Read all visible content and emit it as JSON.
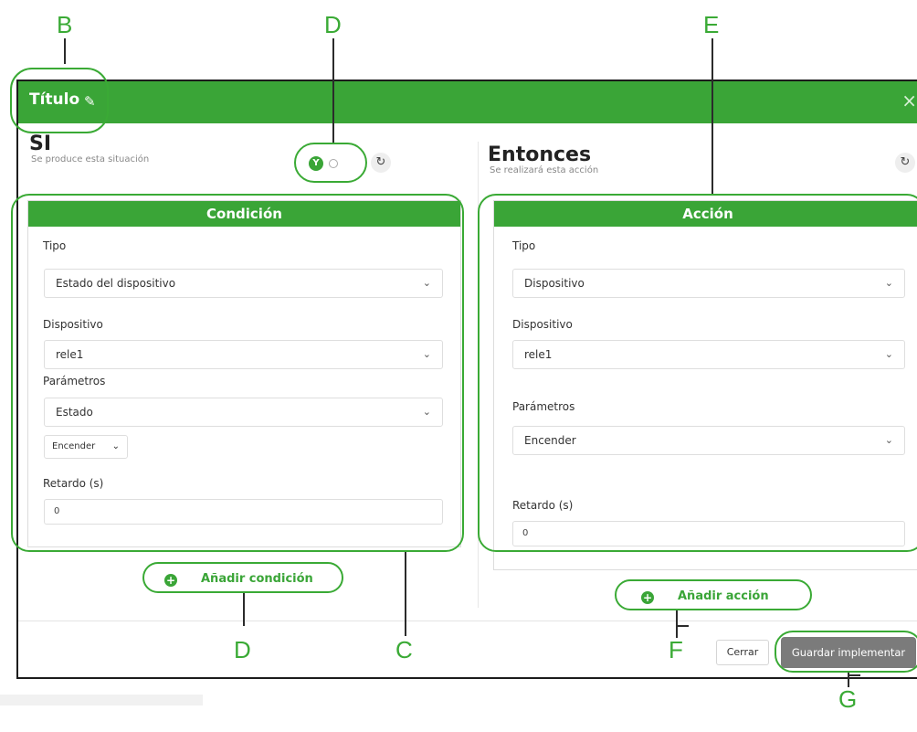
{
  "callouts": {
    "b": "B",
    "d_top": "D",
    "e": "E",
    "d_bottom": "D",
    "c": "C",
    "f": "F",
    "g": "G"
  },
  "dialog": {
    "title": "Título",
    "title_icon": "pencil-icon",
    "close_icon": "close-icon",
    "close_glyph": "×"
  },
  "if_pane": {
    "heading": "SI",
    "subtitle": "Se produce esta situación",
    "toggle": {
      "and_label": "Y",
      "or_label": "O"
    },
    "card": {
      "header": "Condición",
      "type_label": "Tipo",
      "type_value": "Estado del dispositivo",
      "device_label": "Dispositivo",
      "device_value": "rele1",
      "params_label": "Parámetros",
      "params_value": "Estado",
      "state_value": "Encender",
      "delay_label": "Retardo (s)",
      "delay_value": "0"
    },
    "add_label": "Añadir condición"
  },
  "then_pane": {
    "heading": "Entonces",
    "subtitle": "Se realizará esta acción",
    "card": {
      "header": "Acción",
      "type_label": "Tipo",
      "type_value": "Dispositivo",
      "device_label": "Dispositivo",
      "device_value": "rele1",
      "params_label": "Parámetros",
      "params_value": "Encender",
      "delay_label": "Retardo (s)",
      "delay_value": "0"
    },
    "add_label": "Añadir acción"
  },
  "footer": {
    "close_label": "Cerrar",
    "save_label": "Guardar implementar"
  },
  "colors": {
    "brand_green": "#3aa537",
    "callout_green": "#3aaa35",
    "save_button": "#7b7b7b"
  }
}
